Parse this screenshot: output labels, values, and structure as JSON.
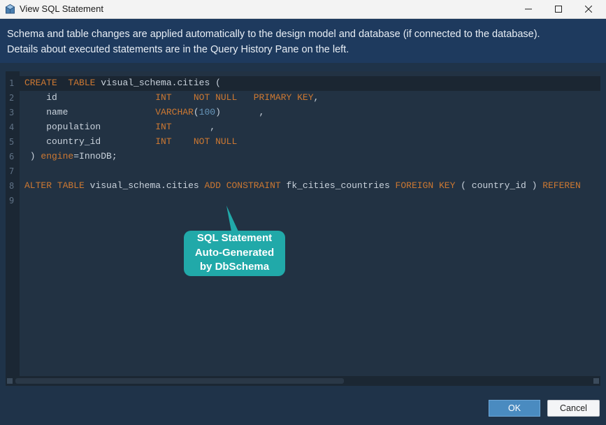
{
  "window": {
    "title": "View SQL Statement",
    "controls": [
      "minimize-icon",
      "maximize-icon",
      "close-icon"
    ]
  },
  "info": {
    "line1": "Schema and table changes are applied automatically to the design model and database (if connected to the database).",
    "line2": "Details about executed statements are in the Query History Pane on the left."
  },
  "editor": {
    "line_numbers": [
      "1",
      "2",
      "3",
      "4",
      "5",
      "6",
      "7",
      "8",
      "9"
    ],
    "lines": [
      "CREATE  TABLE visual_schema.cities (",
      "    id                  INT    NOT NULL   PRIMARY KEY,",
      "    name                VARCHAR(100)       ,",
      "    population          INT       ,",
      "    country_id          INT    NOT NULL",
      " ) engine=InnoDB;",
      "",
      "ALTER TABLE visual_schema.cities ADD CONSTRAINT fk_cities_countries FOREIGN KEY ( country_id ) REFEREN",
      ""
    ],
    "colors": {
      "keyword": "#cc7832",
      "number": "#6897bb",
      "text": "#c9d2dc",
      "background": "#223243"
    }
  },
  "callout": {
    "line1": "SQL Statement",
    "line2": "Auto-Generated",
    "line3": "by DbSchema",
    "color": "#21a9a9"
  },
  "buttons": {
    "ok": "OK",
    "cancel": "Cancel"
  }
}
